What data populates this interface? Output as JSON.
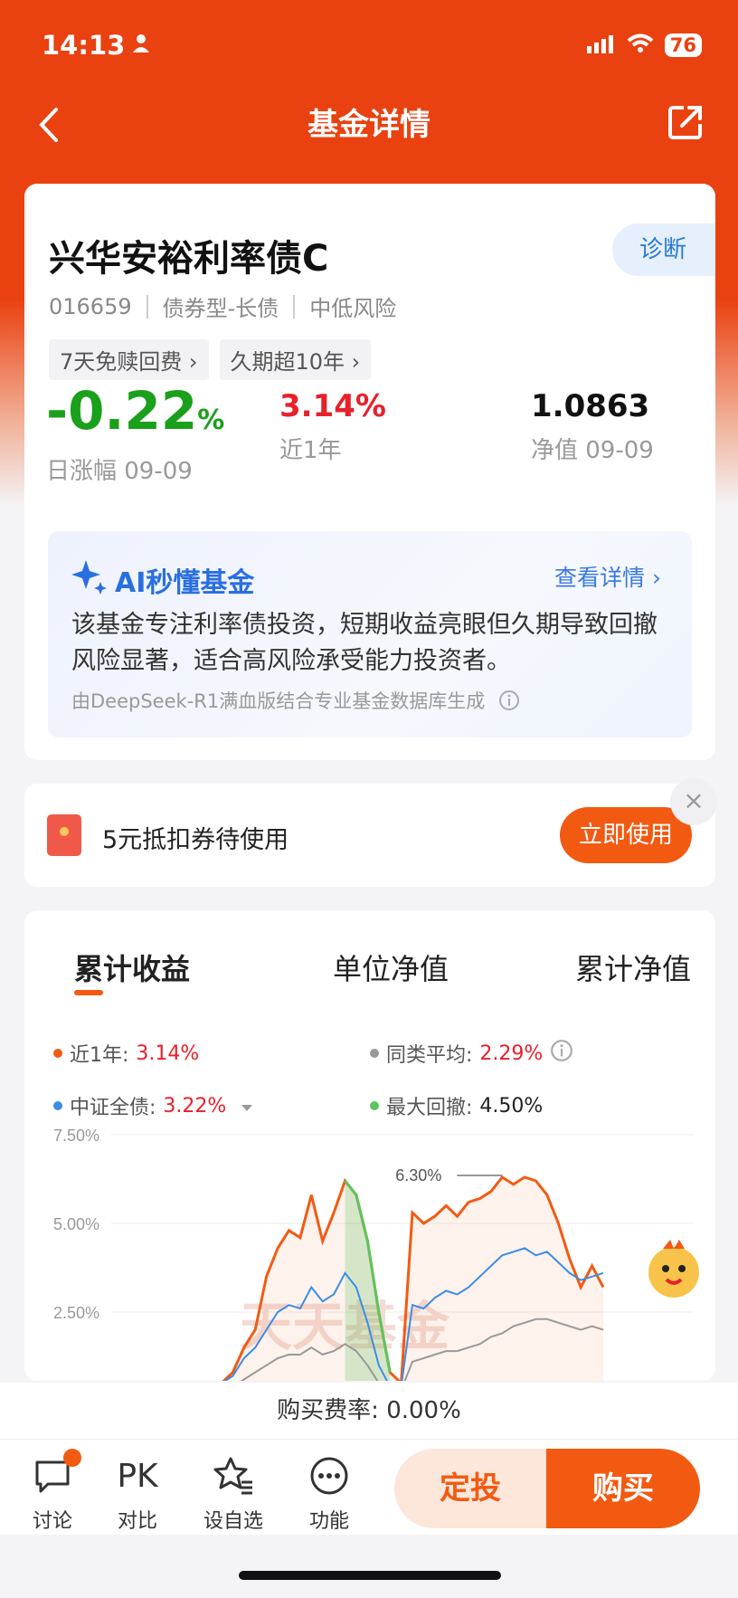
{
  "status": {
    "time": "14:13",
    "battery": "76"
  },
  "nav": {
    "title": "基金详情"
  },
  "fund": {
    "name": "兴华安裕利率债C",
    "diagnose": "诊断",
    "code": "016659",
    "type": "债券型-长债",
    "risk": "中低风险",
    "tags": [
      "7天免赎回费 ›",
      "久期超10年 ›"
    ],
    "daily_change_value": "-0.22",
    "daily_change_unit": "%",
    "daily_change_label": "日涨幅 09-09",
    "year_return": "3.14%",
    "year_return_label": "近1年",
    "nav_value": "1.0863",
    "nav_label": "净值 09-09"
  },
  "ai": {
    "title": "AI秒懂基金",
    "more": "查看详情 ›",
    "text": "该基金专注利率债投资，短期收益亮眼但久期导致回撤风险显著，适合高风险承受能力投资者。",
    "source": "由DeepSeek-R1满血版结合专业基金数据库生成"
  },
  "coupon": {
    "text": "5元抵扣券待使用",
    "button": "立即使用",
    "close": "×"
  },
  "chart_tabs": [
    "累计收益",
    "单位净值",
    "累计净值"
  ],
  "legend": {
    "near1y_label": "近1年:",
    "near1y_value": "3.14%",
    "peer_label": "同类平均:",
    "peer_value": "2.29%",
    "index_label": "中证全债:",
    "index_value": "3.22%",
    "drawdown_label": "最大回撤:",
    "drawdown_value": "4.50%"
  },
  "colors": {
    "fund": "#f25a12",
    "peer": "#999999",
    "index": "#3b8de8",
    "drawdown": "#5cc55c"
  },
  "chart_data": {
    "type": "line",
    "y_ticks": [
      "7.50%",
      "5.00%",
      "2.50%"
    ],
    "ylim": [
      0,
      7.5
    ],
    "annotation": "6.30%",
    "watermark": "天天基金",
    "series": [
      {
        "name": "近1年",
        "values": [
          0.5,
          0.8,
          1.5,
          2.0,
          3.5,
          4.3,
          4.8,
          4.6,
          5.8,
          4.5,
          5.3,
          6.2,
          5.8,
          4.5,
          2.5,
          0.8,
          0.5,
          5.3,
          5.0,
          5.2,
          5.5,
          5.2,
          5.6,
          5.7,
          5.9,
          6.3,
          6.1,
          6.3,
          6.2,
          5.8,
          5.0,
          4.0,
          3.2,
          3.8,
          3.2
        ]
      },
      {
        "name": "中证全债",
        "values": [
          0.5,
          0.7,
          1.2,
          1.5,
          2.0,
          2.5,
          2.7,
          2.6,
          3.2,
          2.8,
          3.0,
          3.6,
          3.2,
          2.2,
          1.0,
          0.4,
          0.4,
          2.7,
          2.6,
          2.9,
          3.1,
          3.0,
          3.2,
          3.5,
          3.8,
          4.1,
          4.2,
          4.3,
          4.1,
          4.2,
          3.9,
          3.6,
          3.4,
          3.5,
          3.6
        ]
      },
      {
        "name": "同类平均",
        "values": [
          0.3,
          0.4,
          0.6,
          0.8,
          1.0,
          1.2,
          1.3,
          1.3,
          1.5,
          1.3,
          1.4,
          1.6,
          1.4,
          1.0,
          0.5,
          0.3,
          0.3,
          1.1,
          1.2,
          1.3,
          1.4,
          1.4,
          1.5,
          1.6,
          1.8,
          1.9,
          2.1,
          2.2,
          2.3,
          2.3,
          2.2,
          2.1,
          2.0,
          2.1,
          2.0
        ]
      }
    ]
  },
  "buy_fee": {
    "label": "购买费率:",
    "value": "0.00%"
  },
  "bottom": {
    "discuss": "讨论",
    "pk_icon": "PK",
    "compare": "对比",
    "watch": "设自选",
    "func": "功能",
    "dingtou": "定投",
    "buy": "购买"
  }
}
